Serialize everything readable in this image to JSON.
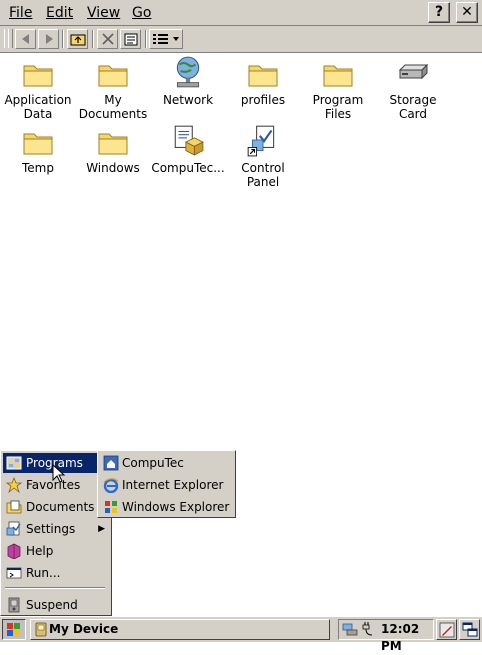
{
  "menubar": {
    "items": [
      {
        "label": "File"
      },
      {
        "label": "Edit"
      },
      {
        "label": "View"
      },
      {
        "label": "Go"
      }
    ],
    "help_label": "?",
    "close_label": "✕"
  },
  "desktop": {
    "icons": [
      {
        "label": "Application Data",
        "icon": "folder-icon"
      },
      {
        "label": "My Documents",
        "icon": "folder-icon"
      },
      {
        "label": "Network",
        "icon": "network-globe-icon"
      },
      {
        "label": "profiles",
        "icon": "folder-icon"
      },
      {
        "label": "Program Files",
        "icon": "folder-icon"
      },
      {
        "label": "Storage Card",
        "icon": "storage-card-icon"
      },
      {
        "label": "Temp",
        "icon": "folder-icon"
      },
      {
        "label": "Windows",
        "icon": "folder-icon"
      },
      {
        "label": "CompuTec...",
        "icon": "computec-app-icon"
      },
      {
        "label": "Control Panel",
        "icon": "control-panel-shortcut-icon"
      }
    ]
  },
  "start_menu": {
    "items": [
      {
        "label": "Programs",
        "icon": "programs-icon",
        "selected": true,
        "submenu": true
      },
      {
        "label": "Favorites",
        "icon": "favorites-star-icon"
      },
      {
        "label": "Documents",
        "icon": "documents-icon"
      },
      {
        "label": "Settings",
        "icon": "settings-icon",
        "submenu": true
      },
      {
        "label": "Help",
        "icon": "help-book-icon"
      },
      {
        "label": "Run...",
        "icon": "run-icon"
      },
      {
        "label": "Suspend",
        "icon": "suspend-icon"
      }
    ],
    "arrow_glyph": "▶"
  },
  "programs_submenu": {
    "items": [
      {
        "label": "CompuTec",
        "icon": "computec-icon"
      },
      {
        "label": "Internet Explorer",
        "icon": "internet-explorer-icon"
      },
      {
        "label": "Windows Explorer",
        "icon": "windows-explorer-icon"
      }
    ]
  },
  "taskbar": {
    "task_label": "My Device",
    "clock": "12:02 PM"
  },
  "colors": {
    "face": "#d4d0c8",
    "selection": "#0a246a",
    "folder": "#f6d66a"
  }
}
